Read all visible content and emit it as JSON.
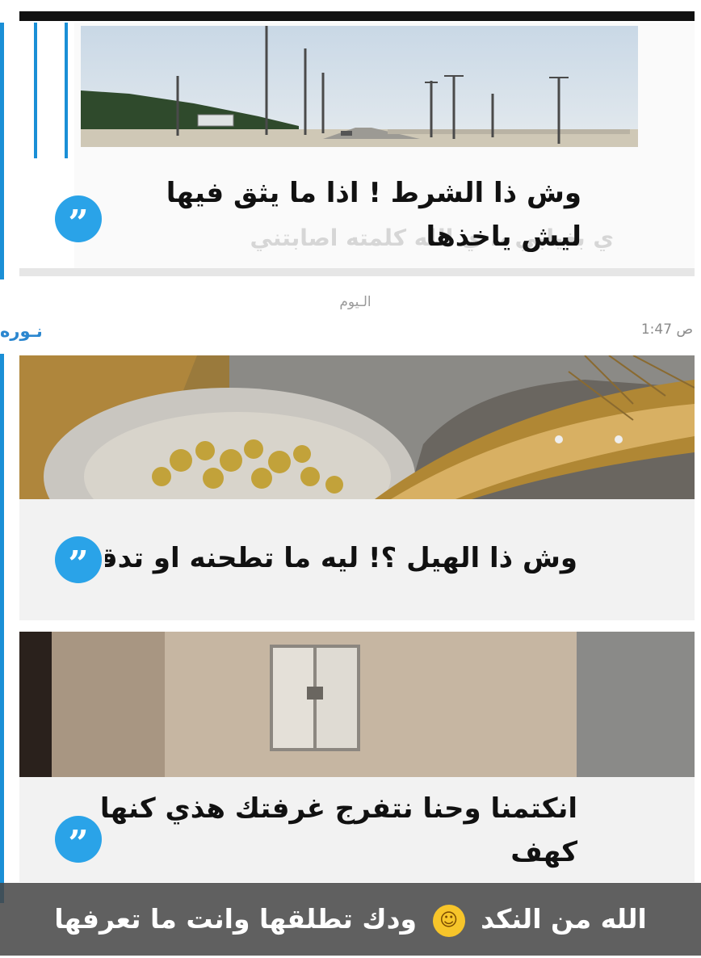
{
  "top_bar": {},
  "messages": [
    {
      "quote_text": "وش ذا الشرط ! اذا ما يثق فيها ليش ياخذها",
      "ghost_text": "ي بغيابي ،، ي الله كلمته اصابتني",
      "image": "road with power poles"
    },
    {
      "quote_text": "وش ذا الهيل ؟! ليه ما تطحنه او تدقه",
      "image": "cardamom in metal bowls"
    },
    {
      "quote_text": "انكتمنا وحنا نتفرج غرفتك هذي كنها كهف",
      "image": "mud wall with small wooden window"
    }
  ],
  "day_separator": "الـيوم",
  "sender_name": "نـوره",
  "time": "1:47 ص",
  "caption": {
    "before": "الله من النكد",
    "emoji": "grinning-sweat-emoji",
    "after": "ودك تطلقها وانت ما تعرفها"
  },
  "icons": {
    "quote": "quote-icon"
  },
  "colors": {
    "accent": "#2aa3e8",
    "line": "#1a8fd6",
    "sender": "#2a86cf"
  }
}
